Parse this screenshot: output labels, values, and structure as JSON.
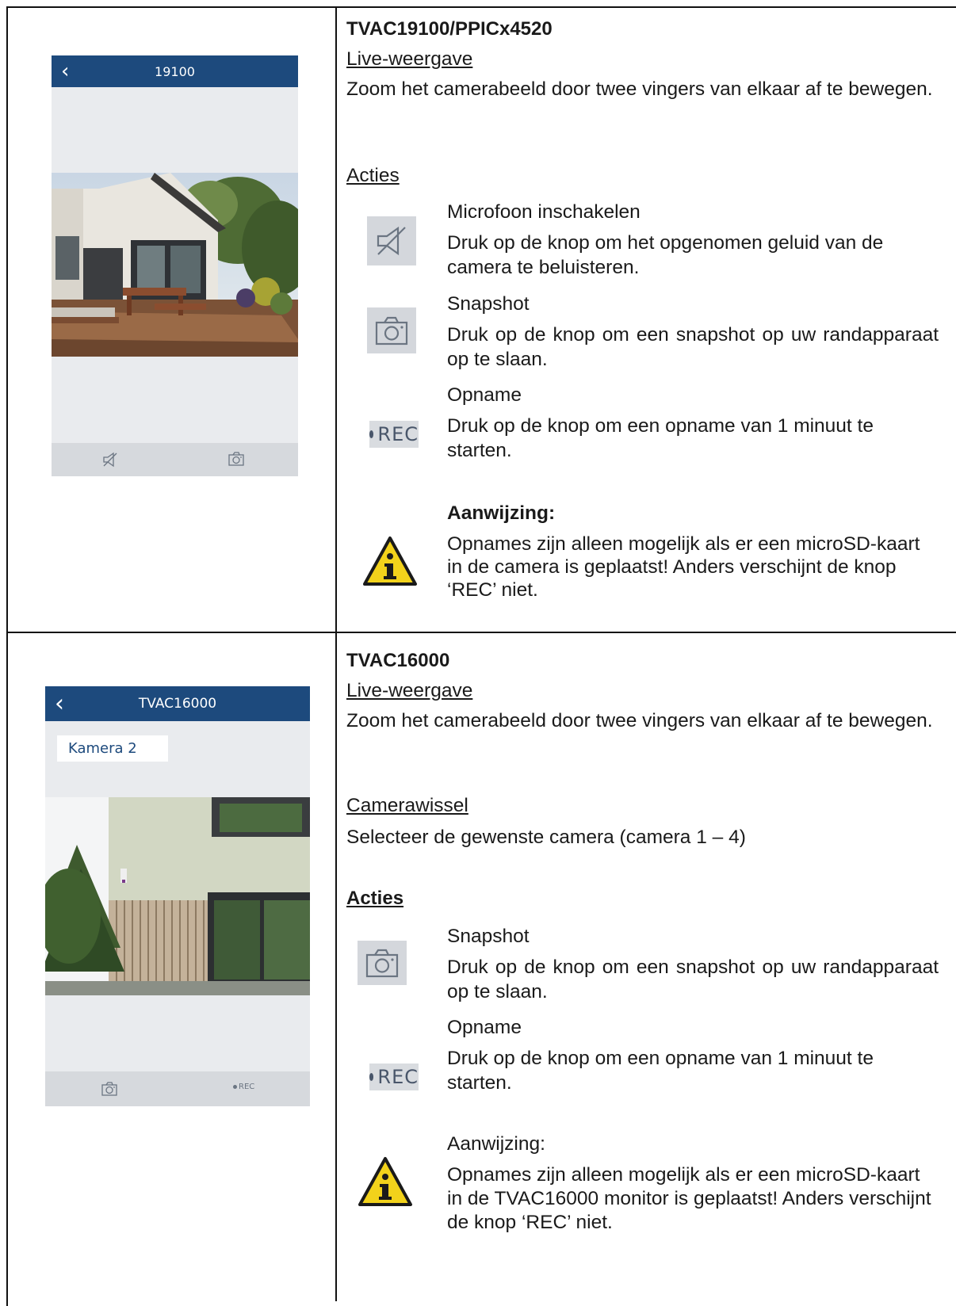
{
  "section1": {
    "title": "TVAC19100/PPICx4520",
    "live_heading": "Live-weergave",
    "live_text": "Zoom het camerabeeld door twee vingers van elkaar af te bewegen.",
    "actions_heading": "Acties",
    "mic": {
      "title": "Microfoon inschakelen",
      "text": "Druk op de knop om het opgenomen geluid van de camera te beluisteren."
    },
    "snapshot": {
      "title": "Snapshot",
      "text": "Druk op de knop om een snapshot op uw randapparaat op te slaan."
    },
    "record": {
      "title": "Opname",
      "text": "Druk op de knop om een opname van 1 minuut te starten."
    },
    "note": {
      "title": "Aanwijzing:",
      "text": "Opnames zijn alleen mogelijk als er een microSD-kaart in de camera is geplaatst! Anders verschijnt de knop ‘REC’ niet."
    },
    "phone": {
      "title": "19100"
    }
  },
  "section2": {
    "title": "TVAC16000",
    "live_heading": "Live-weergave",
    "live_text": "Zoom het camerabeeld door twee vingers van elkaar af te bewegen.",
    "switch_heading": "Camerawissel",
    "switch_text": "Selecteer de gewenste camera (camera 1 – 4)",
    "actions_heading": "Acties",
    "snapshot": {
      "title": "Snapshot",
      "text": "Druk op de knop om een snapshot op uw randapparaat op te slaan."
    },
    "record": {
      "title": "Opname",
      "text": "Druk op de knop om een opname van 1 minuut te starten."
    },
    "note": {
      "title": "Aanwijzing:",
      "text": "Opnames zijn alleen mogelijk als er een microSD-kaart in de TVAC16000 monitor is geplaatst! Anders verschijnt de knop ‘REC’ niet."
    },
    "phone": {
      "title": "TVAC16000",
      "camera_select": "Kamera 2"
    }
  },
  "rec_label": "REC",
  "icons": {
    "back": "chevron-left-icon",
    "mic": "microphone-muted-icon",
    "camera": "camera-icon",
    "warning": "warning-info-icon"
  },
  "colors": {
    "app_bar": "#1d4a7d",
    "app_bg": "#e9ebee",
    "tray": "#d6d9dd",
    "icon": "#49566a",
    "warning": "#f2d21b"
  }
}
